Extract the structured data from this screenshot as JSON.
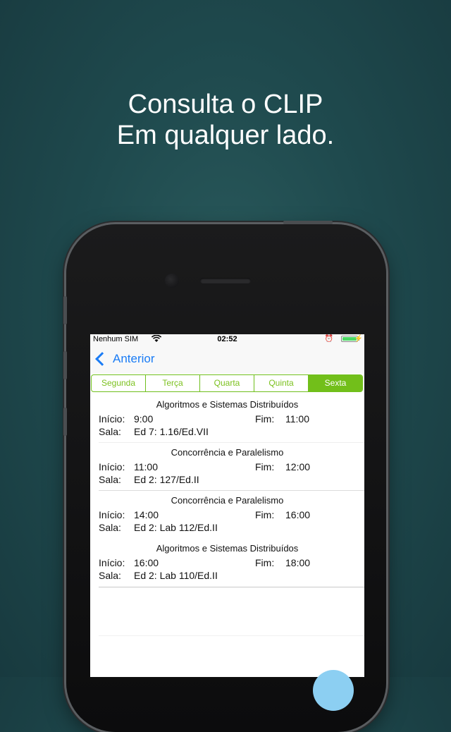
{
  "headline": {
    "line1": "Consulta o CLIP",
    "line2": "Em qualquer lado."
  },
  "status_bar": {
    "carrier": "Nenhum SIM",
    "time": "02:52",
    "wifi_icon": "wifi-icon",
    "alarm_icon": "alarm-icon",
    "battery_color": "#4cd964"
  },
  "nav": {
    "back_label": "Anterior"
  },
  "days": {
    "items": [
      "Segunda",
      "Terça",
      "Quarta",
      "Quinta",
      "Sexta"
    ],
    "selected": "Sexta",
    "accent": "#72bf1a"
  },
  "labels": {
    "start": "Início:",
    "end": "Fim:",
    "room": "Sala:"
  },
  "classes": [
    {
      "title": "Algoritmos e Sistemas Distribuídos",
      "start": "9:00",
      "end": "11:00",
      "room": "Ed 7: 1.16/Ed.VII"
    },
    {
      "title": "Concorrência e Paralelismo",
      "start": "11:00",
      "end": "12:00",
      "room": "Ed 2: 127/Ed.II"
    },
    {
      "title": "Concorrência e Paralelismo",
      "start": "14:00",
      "end": "16:00",
      "room": "Ed 2: Lab 112/Ed.II"
    },
    {
      "title": "Algoritmos e Sistemas Distribuídos",
      "start": "16:00",
      "end": "18:00",
      "room": "Ed 2: Lab 110/Ed.II"
    }
  ]
}
